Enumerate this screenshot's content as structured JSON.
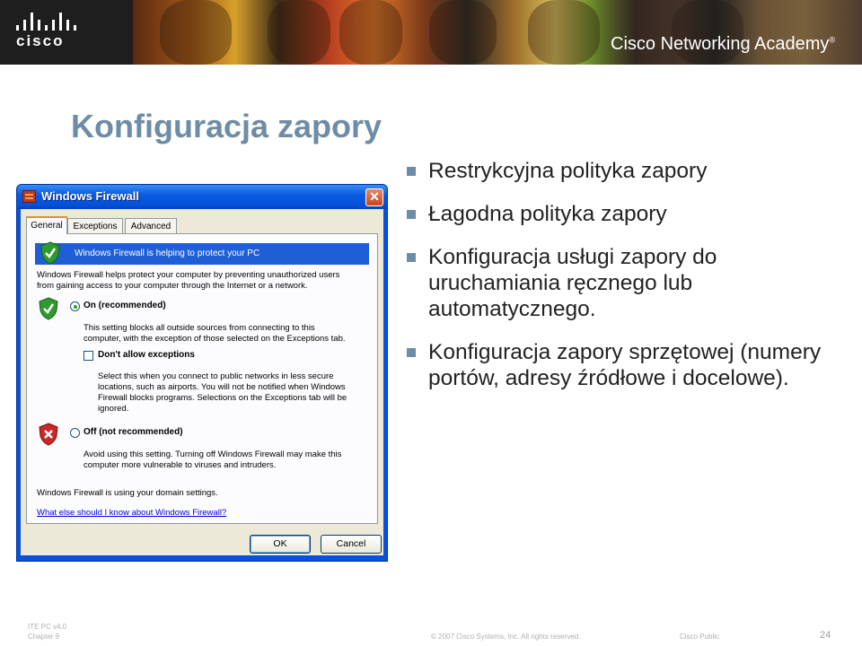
{
  "header": {
    "brand_logo_text": "cisco",
    "academy_label": "Cisco Networking Academy",
    "academy_trademark": "®"
  },
  "slide": {
    "title": "Konfiguracja zapory",
    "bullets": [
      "Restrykcyjna polityka zapory",
      "Łagodna polityka zapory",
      "Konfiguracja usługi zapory do uruchamiania ręcznego lub automatycznego.",
      "Konfiguracja zapory sprzętowej (numery portów, adresy źródłowe i docelowe)."
    ],
    "bullet_color": "#6d8ca6",
    "title_color": "#6d8ca6"
  },
  "dialog": {
    "title": "Windows Firewall",
    "close_glyph": "✕",
    "tabs": [
      "General",
      "Exceptions",
      "Advanced"
    ],
    "active_tab": "General",
    "status_message": "Windows Firewall is helping to protect your PC",
    "intro_lines": [
      "Windows Firewall helps protect your computer by preventing unauthorized users",
      "from gaining access to your computer through the Internet or a network."
    ],
    "options": {
      "on": {
        "label": "On (recommended)",
        "checked": true,
        "description_lines": [
          "This setting blocks all outside sources from connecting to this",
          "computer, with the exception of those selected on the Exceptions tab."
        ]
      },
      "dont_allow": {
        "label": "Don't allow exceptions",
        "checked": false,
        "description_lines": [
          "Select this when you connect to public networks in less secure",
          "locations, such as airports. You will not be notified when Windows",
          "Firewall blocks programs. Selections on the Exceptions tab will be",
          "ignored."
        ]
      },
      "off": {
        "label": "Off (not recommended)",
        "checked": false,
        "description_lines": [
          "Avoid using this setting. Turning off Windows Firewall may make this",
          "computer more vulnerable to viruses and intruders."
        ]
      }
    },
    "domain_settings_text": "Windows Firewall is using your domain settings.",
    "help_link": "What else should I know about Windows Firewall?",
    "buttons": {
      "ok": "OK",
      "cancel": "Cancel"
    },
    "icons": {
      "app": "firewall-brick-icon",
      "status": "shield-check-icon",
      "on": "shield-check-icon",
      "off": "shield-x-icon"
    }
  },
  "footer": {
    "course": "ITE PC v4.0",
    "chapter": "Chapter 9",
    "copyright": "© 2007 Cisco Systems, Inc. All rights reserved.",
    "classification": "Cisco Public",
    "page_number": "24"
  }
}
